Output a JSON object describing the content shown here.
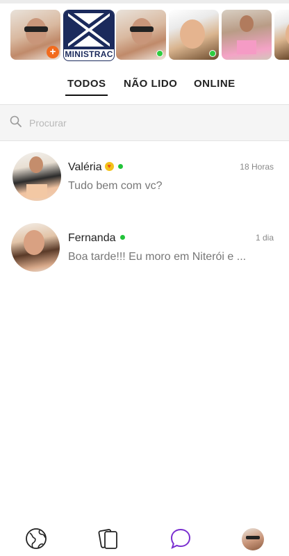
{
  "stories": [
    {
      "type": "photo",
      "icon": "man-sunglasses-photo",
      "add_label": "+",
      "online": false
    },
    {
      "type": "logo",
      "logo_text": "MINISTRAC"
    },
    {
      "type": "photo",
      "icon": "man-sunglasses-photo",
      "online": true
    },
    {
      "type": "photo",
      "icon": "woman-selfie-photo",
      "online": true
    },
    {
      "type": "photo",
      "icon": "woman-mirror-photo",
      "online": false
    }
  ],
  "tabs": [
    {
      "label": "TODOS",
      "active": true
    },
    {
      "label": "NÃO LIDO",
      "active": false
    },
    {
      "label": "ONLINE",
      "active": false
    }
  ],
  "search": {
    "placeholder": "Procurar",
    "icon": "search-icon"
  },
  "chats": [
    {
      "name": "Valéria",
      "badge": "vip-badge-icon",
      "online": true,
      "time": "18 Horas",
      "preview": "Tudo bem com vc?"
    },
    {
      "name": "Fernanda",
      "online": true,
      "time": "1 dia",
      "preview": "Boa tarde!!! Eu moro em Niterói e ..."
    }
  ],
  "bottom_nav": [
    {
      "icon": "globe-icon",
      "active": false
    },
    {
      "icon": "cards-icon",
      "active": false
    },
    {
      "icon": "chat-bubble-icon",
      "active": true
    },
    {
      "icon": "profile-avatar",
      "active": false
    }
  ],
  "colors": {
    "accent": "#7a2fd0",
    "online": "#22c33a",
    "add_button": "#f26b1d",
    "logo_navy": "#1b2a5c"
  }
}
